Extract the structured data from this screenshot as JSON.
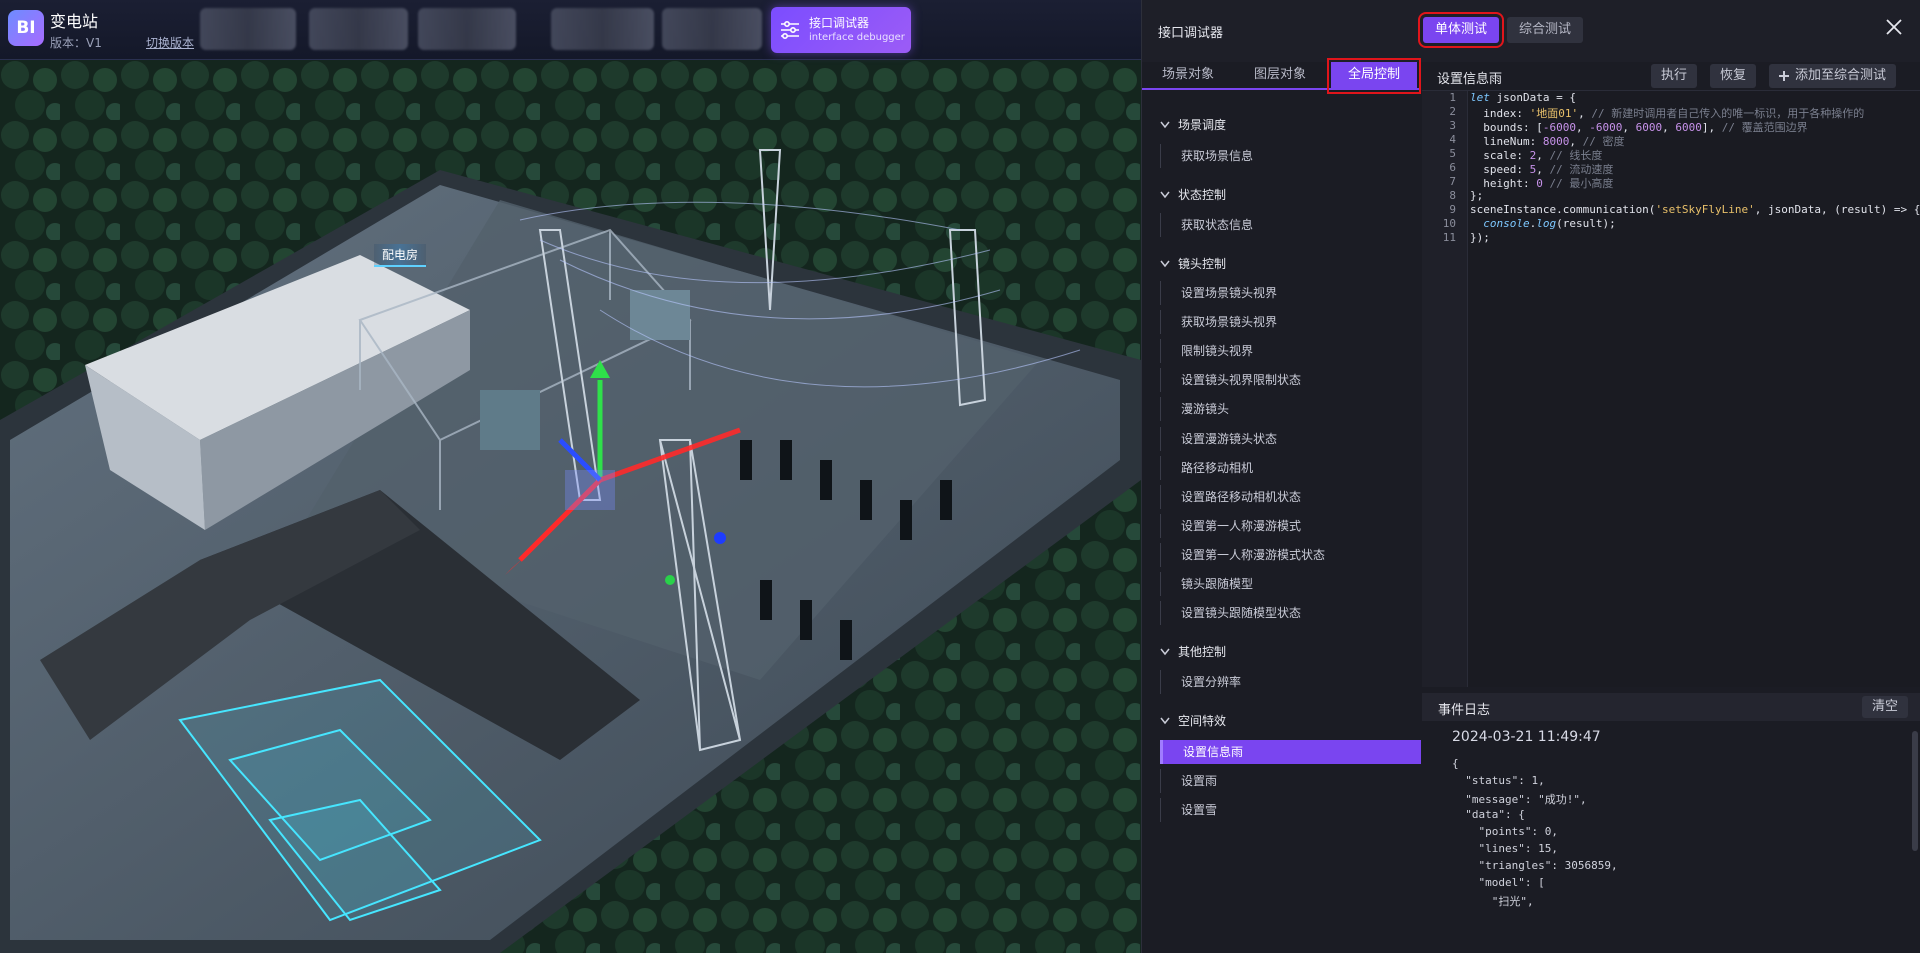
{
  "topbar": {
    "logo_text": "BI",
    "title": "变电站",
    "version": "版本：V1",
    "switch_version": "切换版本",
    "debug_button": {
      "label_cn": "接口调试器",
      "label_en": "interface debugger"
    }
  },
  "scene": {
    "building_label": "配电房"
  },
  "panel": {
    "title": "接口调试器",
    "mode_unit": "单体测试",
    "mode_all": "综合测试",
    "tabs": [
      {
        "label": "场景对象"
      },
      {
        "label": "图层对象"
      },
      {
        "label": "全局控制",
        "active": true
      }
    ],
    "tree": [
      {
        "group": "场景调度",
        "items": [
          "获取场景信息"
        ]
      },
      {
        "group": "状态控制",
        "items": [
          "获取状态信息"
        ]
      },
      {
        "group": "镜头控制",
        "items": [
          "设置场景镜头视界",
          "获取场景镜头视界",
          "限制镜头视界",
          "设置镜头视界限制状态",
          "漫游镜头",
          "设置漫游镜头状态",
          "路径移动相机",
          "设置路径移动相机状态",
          "设置第一人称漫游模式",
          "设置第一人称漫游模式状态",
          "镜头跟随模型",
          "设置镜头跟随模型状态"
        ]
      },
      {
        "group": "其他控制",
        "items": [
          "设置分辨率"
        ]
      },
      {
        "group": "空间特效",
        "items": [
          "设置信息雨",
          "设置雨",
          "设置雪"
        ]
      }
    ],
    "selected_item": "设置信息雨"
  },
  "editor": {
    "title": "设置信息雨",
    "btn_run": "执行",
    "btn_restore": "恢复",
    "btn_add": "添加至综合测试",
    "lines": [
      [
        [
          "kw",
          "let"
        ],
        [
          "t",
          " jsonData = {"
        ]
      ],
      [
        [
          "t",
          "  index: "
        ],
        [
          "str",
          "'地面01'"
        ],
        [
          "t",
          ", "
        ],
        [
          "cmt",
          "// 新建时调用者自己传入的唯一标识，用于各种操作的"
        ]
      ],
      [
        [
          "t",
          "  bounds: ["
        ],
        [
          "num",
          "-6000"
        ],
        [
          "t",
          ", "
        ],
        [
          "num",
          "-6000"
        ],
        [
          "t",
          ", "
        ],
        [
          "num",
          "6000"
        ],
        [
          "t",
          ", "
        ],
        [
          "num",
          "6000"
        ],
        [
          "t",
          "], "
        ],
        [
          "cmt",
          "// 覆盖范围边界"
        ]
      ],
      [
        [
          "t",
          "  lineNum: "
        ],
        [
          "num",
          "8000"
        ],
        [
          "t",
          ", "
        ],
        [
          "cmt",
          "// 密度"
        ]
      ],
      [
        [
          "t",
          "  scale: "
        ],
        [
          "num",
          "2"
        ],
        [
          "t",
          ", "
        ],
        [
          "cmt",
          "// 线长度"
        ]
      ],
      [
        [
          "t",
          "  speed: "
        ],
        [
          "num",
          "5"
        ],
        [
          "t",
          ", "
        ],
        [
          "cmt",
          "// 流动速度"
        ]
      ],
      [
        [
          "t",
          "  height: "
        ],
        [
          "num",
          "0"
        ],
        [
          "t",
          " "
        ],
        [
          "cmt",
          "// 最小高度"
        ]
      ],
      [
        [
          "t",
          "};"
        ]
      ],
      [
        [
          "t",
          "sceneInstance.communication("
        ],
        [
          "str",
          "'setSkyFlyLine'"
        ],
        [
          "t",
          ", jsonData, (result) => {"
        ]
      ],
      [
        [
          "t",
          "  "
        ],
        [
          "fn",
          "console"
        ],
        [
          "t",
          "."
        ],
        [
          "fn",
          "log"
        ],
        [
          "t",
          "(result);"
        ]
      ],
      [
        [
          "t",
          "});"
        ]
      ]
    ]
  },
  "log": {
    "title": "事件日志",
    "clear": "清空",
    "time": "2024-03-21 11:49:47",
    "lines": [
      "{",
      "  \"status\": 1,",
      "  \"message\": \"成功!\",",
      "  \"data\": {",
      "    \"points\": 0,",
      "    \"lines\": 15,",
      "    \"triangles\": 3056859,",
      "    \"model\": [",
      "      \"扫光\","
    ]
  },
  "colors": {
    "accent": "#7a45f0",
    "highlight_box": "#e0151b",
    "panel_bg": "#1b1c24"
  }
}
